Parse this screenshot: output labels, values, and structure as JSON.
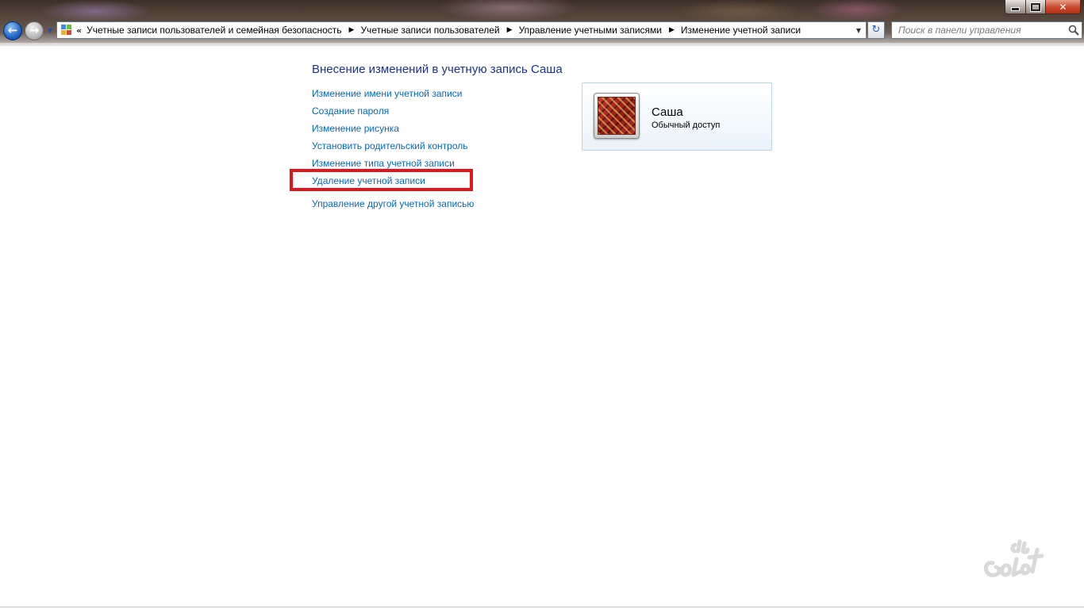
{
  "window": {
    "minimize_icon": "minimize-icon",
    "maximize_icon": "maximize-icon",
    "close_glyph": "✕"
  },
  "nav": {
    "back_glyph": "←",
    "forward_glyph": "→",
    "history_glyph": "▼"
  },
  "address": {
    "overflow_glyph": "«",
    "separator_glyph": "▶",
    "crumbs": [
      "Учетные записи пользователей и семейная безопасность",
      "Учетные записи пользователей",
      "Управление учетными записями",
      "Изменение учетной записи"
    ],
    "dropdown_glyph": "▼",
    "refresh_glyph": "↻"
  },
  "search": {
    "placeholder": "Поиск в панели управления"
  },
  "main": {
    "title": "Внесение изменений в учетную запись Саша",
    "tasks": [
      "Изменение имени учетной записи",
      "Создание пароля",
      "Изменение рисунка",
      "Установить родительский контроль",
      "Изменение типа учетной записи",
      "Удаление учетной записи"
    ],
    "other_account_link": "Управление другой учетной записью",
    "highlight_color": "#e2141e",
    "link_color": "#0a66b8"
  },
  "account": {
    "name": "Саша",
    "type": "Обычный доступ"
  }
}
